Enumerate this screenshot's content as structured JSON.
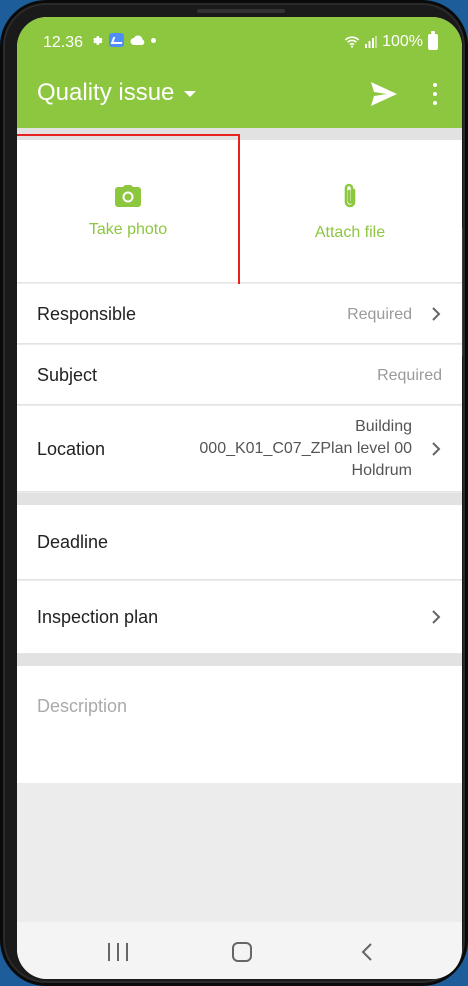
{
  "status_bar": {
    "time": "12.36",
    "battery": "100%"
  },
  "app_bar": {
    "title": "Quality issue",
    "send_icon": "send-icon",
    "more_icon": "more-vert-icon"
  },
  "media": {
    "take_photo_label": "Take photo",
    "attach_file_label": "Attach file"
  },
  "fields": {
    "responsible": {
      "label": "Responsible",
      "value": "Required"
    },
    "subject": {
      "label": "Subject",
      "value": "Required"
    },
    "location": {
      "label": "Location",
      "value_line1": "Building",
      "value_line2": "000_K01_C07_ZPlan level 00",
      "value_line3": "Holdrum"
    },
    "deadline": {
      "label": "Deadline"
    },
    "inspection_plan": {
      "label": "Inspection plan"
    }
  },
  "description": {
    "placeholder": "Description"
  },
  "colors": {
    "accent": "#8dc63f",
    "highlight": "#e8201f"
  }
}
